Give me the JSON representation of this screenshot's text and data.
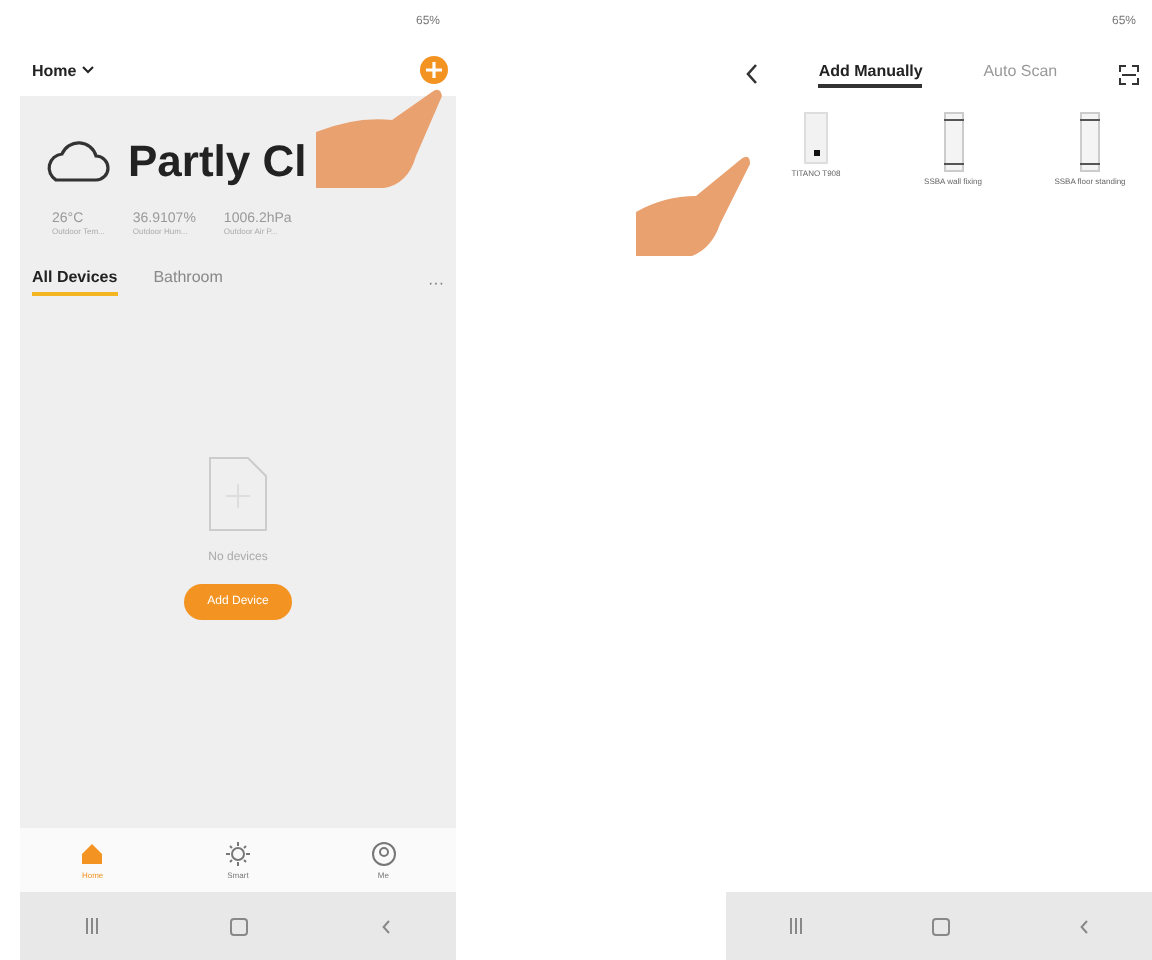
{
  "left_screen": {
    "status_bar": {
      "battery": "65%"
    },
    "header": {
      "home": "Home"
    },
    "weather": {
      "condition": "Partly Cl",
      "stats": [
        {
          "value": "26°C",
          "label": "Outdoor Tem..."
        },
        {
          "value": "36.9107%",
          "label": "Outdoor Hum..."
        },
        {
          "value": "1006.2hPa",
          "label": "Outdoor Air P..."
        }
      ]
    },
    "rooms": [
      {
        "label": "All Devices",
        "selected": true
      },
      {
        "label": "Bathroom",
        "selected": false
      }
    ],
    "more": "···",
    "empty_state": {
      "message": "No devices",
      "button": "Add Device"
    },
    "bottom_tabs": [
      {
        "label": "Home",
        "kind": "home",
        "selected": true
      },
      {
        "label": "Smart",
        "kind": "smart",
        "selected": false
      },
      {
        "label": "Me",
        "kind": "me",
        "selected": false
      }
    ]
  },
  "right_screen": {
    "status_bar": {
      "battery": "65%"
    },
    "tabs": [
      {
        "label": "Add Manually",
        "selected": true
      },
      {
        "label": "Auto Scan",
        "selected": false
      }
    ],
    "devices": [
      {
        "name": "TITANO T908",
        "kind": "box"
      },
      {
        "name": "SSBA wall fixing",
        "kind": "column"
      },
      {
        "name": "SSBA floor standing",
        "kind": "column"
      }
    ]
  }
}
